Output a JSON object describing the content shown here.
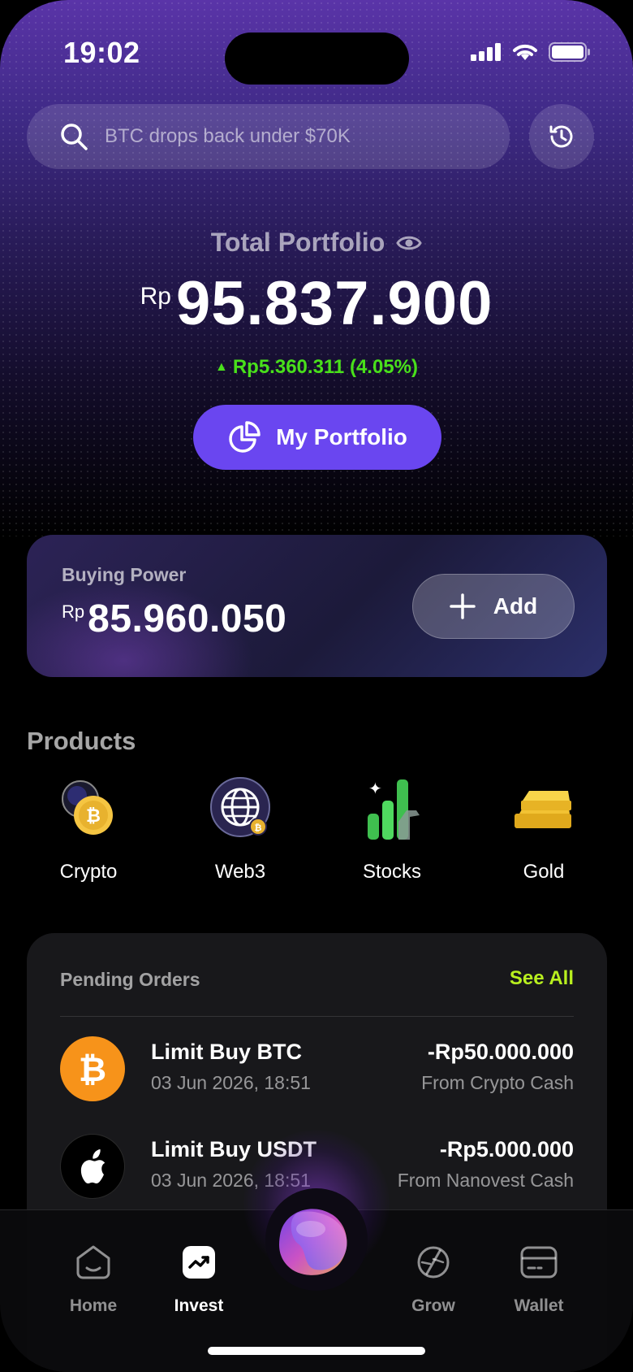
{
  "status_bar": {
    "time": "19:02"
  },
  "search": {
    "placeholder": "BTC drops back under $70K"
  },
  "portfolio": {
    "label": "Total Portfolio",
    "currency": "Rp",
    "value": "95.837.900",
    "change": "Rp5.360.311 (4.05%)",
    "button_label": "My Portfolio"
  },
  "buying_power": {
    "label": "Buying Power",
    "currency": "Rp",
    "value": "85.960.050",
    "add_label": "Add"
  },
  "products": {
    "title": "Products",
    "items": [
      {
        "label": "Crypto",
        "icon": "crypto-icon"
      },
      {
        "label": "Web3",
        "icon": "web3-icon"
      },
      {
        "label": "Stocks",
        "icon": "stocks-icon"
      },
      {
        "label": "Gold",
        "icon": "gold-icon"
      }
    ]
  },
  "pending_orders": {
    "title": "Pending Orders",
    "see_all": "See All",
    "items": [
      {
        "name": "Limit Buy BTC",
        "date": "03 Jun 2026, 18:51",
        "amount": "-Rp50.000.000",
        "source": "From Crypto Cash",
        "icon": "bitcoin-icon",
        "icon_color": "#f7931a"
      },
      {
        "name": "Limit Buy USDT",
        "date": "03 Jun 2026, 18:51",
        "amount": "-Rp5.000.000",
        "source": "From Nanovest Cash",
        "icon": "apple-icon",
        "icon_color": "#000000"
      }
    ]
  },
  "nav": {
    "items": [
      {
        "label": "Home",
        "active": false
      },
      {
        "label": "Invest",
        "active": true
      },
      {
        "label": "Grow",
        "active": false
      },
      {
        "label": "Wallet",
        "active": false
      }
    ]
  },
  "colors": {
    "accent": "#6a46f0",
    "positive": "#49e01b",
    "see_all": "#b8ef1f"
  }
}
